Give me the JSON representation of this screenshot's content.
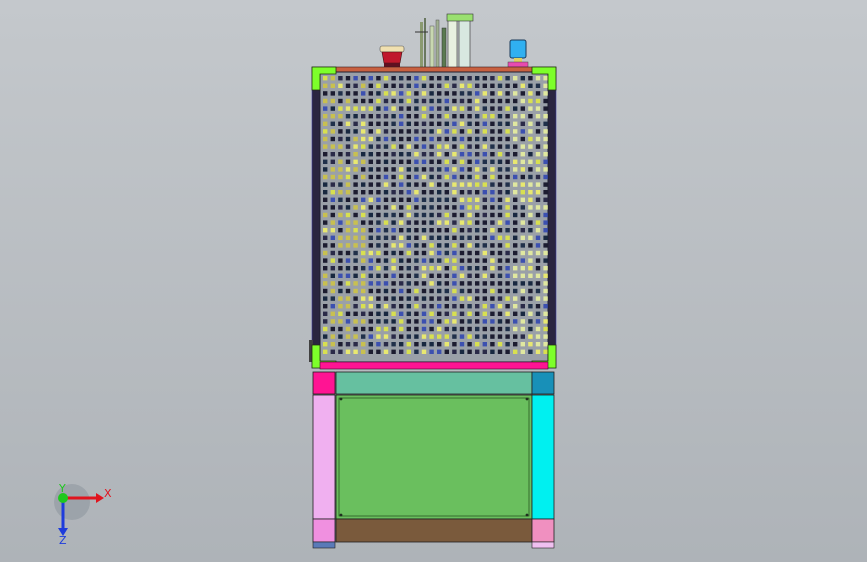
{
  "viewport": {
    "background_top": "#c4c8cc",
    "background_bottom": "#aeb3b8"
  },
  "triad": {
    "x_label": "X",
    "y_label": "Y",
    "z_label": "Z",
    "x_color": "#e0141e",
    "y_color": "#1ec81e",
    "z_color": "#1e3cdc"
  },
  "model": {
    "colors": {
      "frame_green": "#7dff2a",
      "panel_dark": "#2a2540",
      "mesh_hole": "#1c1c30",
      "mesh_face": "#9aa0a8",
      "magenta": "#ff1493",
      "teal_panel": "#66c0a0",
      "green_panel": "#6abf5e",
      "brown_base": "#7a5a3c",
      "left_pink": "#f0b0f0",
      "right_cyan": "#00f0f0",
      "corner_blue": "#1890b8",
      "light_pink": "#f090c0",
      "lamp_red": "#c0182c",
      "cup_blue": "#30b0f0"
    }
  }
}
